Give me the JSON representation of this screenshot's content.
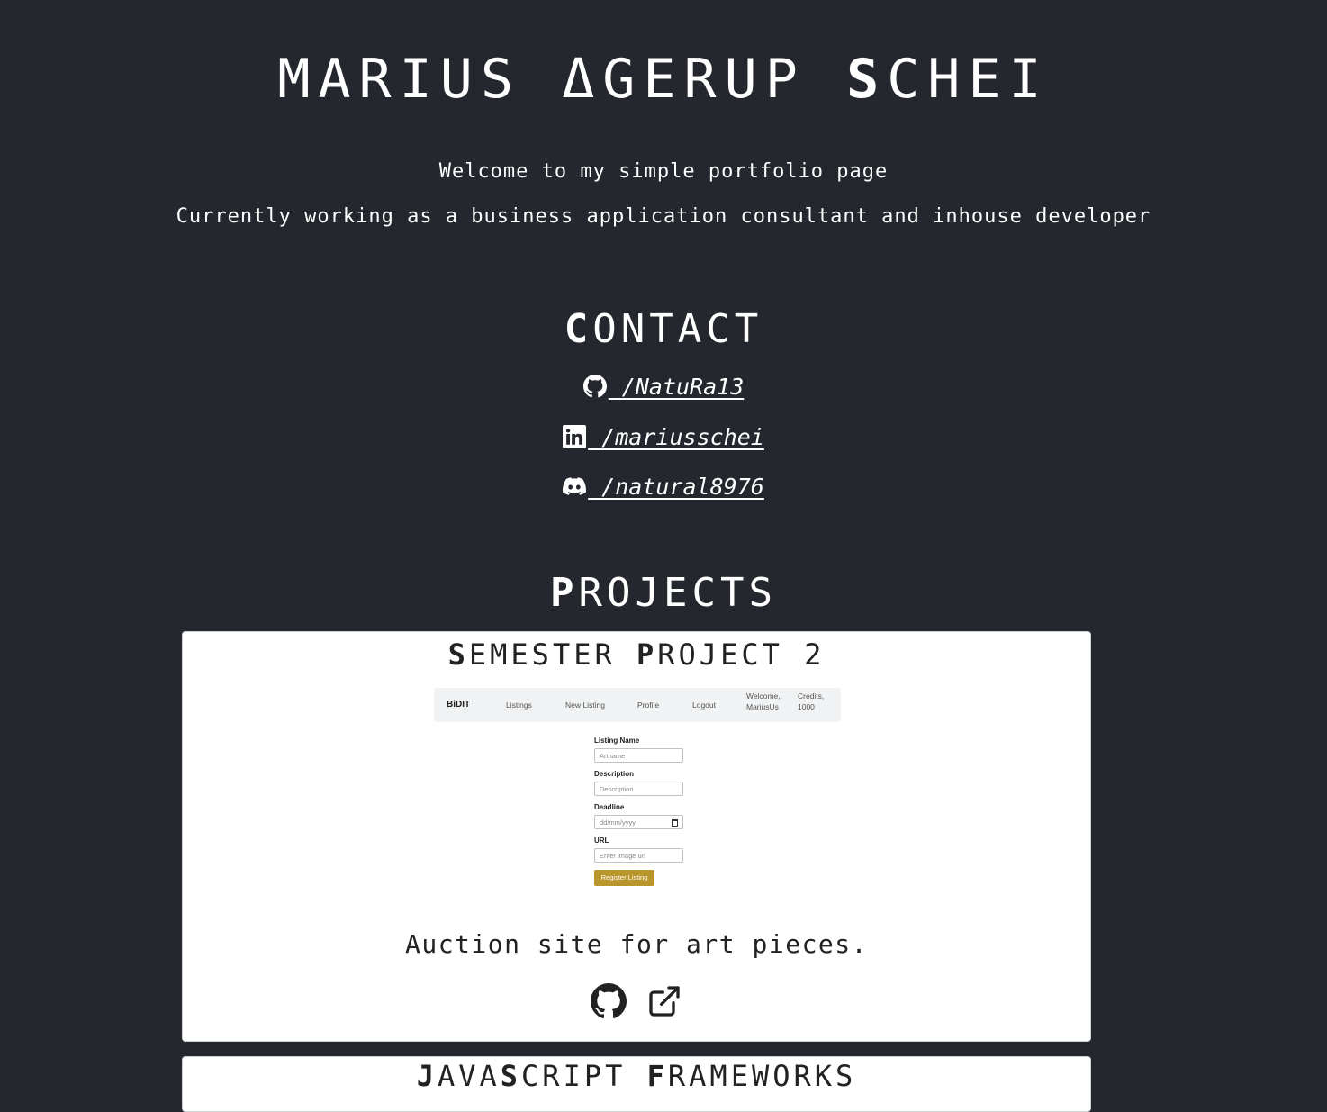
{
  "header": {
    "name_parts": [
      {
        "cap": "",
        "rest": "MARIUS "
      },
      {
        "cap": "",
        "rest": "ΔGERUP "
      },
      {
        "cap": "S",
        "rest": "CHEI"
      }
    ]
  },
  "intro": {
    "welcome": "Welcome to my simple portfolio page",
    "tagline": "Currently working as a business application consultant and inhouse developer"
  },
  "contact": {
    "title_cap": "C",
    "title_rest": "ONTACT",
    "links": [
      {
        "icon": "github-icon",
        "text": " /NatuRa13"
      },
      {
        "icon": "linkedin-icon",
        "text": " /mariusschei"
      },
      {
        "icon": "discord-icon",
        "text": " /natural8976"
      }
    ]
  },
  "projects": {
    "title_cap": "P",
    "title_rest": "ROJECTS",
    "items": [
      {
        "title_parts": [
          {
            "cap": "S",
            "rest": "EMESTER "
          },
          {
            "cap": "P",
            "rest": "ROJECT 2"
          }
        ],
        "screenshot": {
          "brand": "BiDIT",
          "nav": [
            "Listings",
            "New Listing",
            "Profile",
            "Logout"
          ],
          "welcome_line1": "Welcome,",
          "welcome_line2": "MariusUs",
          "credits_line1": "Credits,",
          "credits_line2": "1000",
          "fields": [
            {
              "label": "Listing Name",
              "placeholder": "Artname"
            },
            {
              "label": "Description",
              "placeholder": "Description"
            },
            {
              "label": "Deadline",
              "placeholder": "dd/mm/yyyy"
            },
            {
              "label": "URL",
              "placeholder": "Enter image url"
            }
          ],
          "button": "Register Listing",
          "button_color": "#b9962c"
        },
        "description": "Auction site for art pieces.",
        "icons": [
          "github-icon",
          "external-link-icon"
        ]
      },
      {
        "title_parts": [
          {
            "cap": "J",
            "rest": "AVA"
          },
          {
            "cap": "S",
            "rest": "CRIPT "
          },
          {
            "cap": "F",
            "rest": "RAMEWORKS"
          }
        ]
      }
    ]
  },
  "colors": {
    "background": "#24272e",
    "text": "#ffffff",
    "card": "#ffffff"
  }
}
